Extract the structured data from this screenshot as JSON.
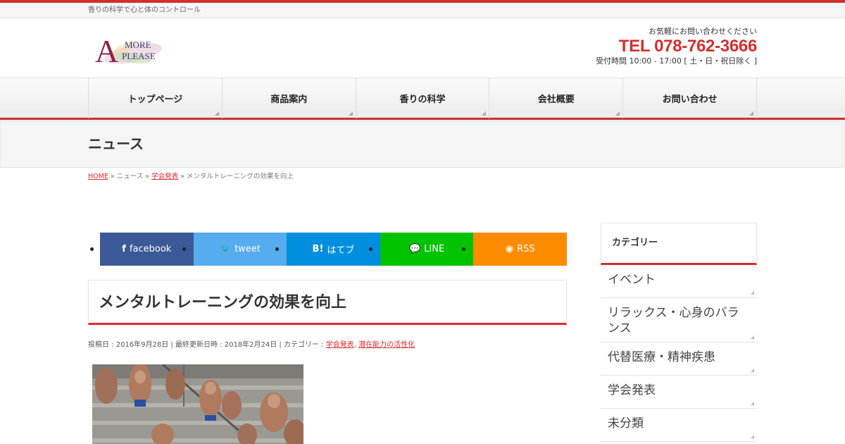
{
  "topbar": {
    "tagline": "香りの科学で心と体のコントロール"
  },
  "logo": {
    "letter": "A",
    "line1": "MORE",
    "line2": "PLEASE"
  },
  "contact": {
    "question": "お気軽にお問い合わせください",
    "tel": "TEL 078-762-3666",
    "hours": "受付時間 10:00 - 17:00 [ 土・日・祝日除く ]"
  },
  "nav": [
    "トップページ",
    "商品案内",
    "香りの科学",
    "会社概要",
    "お問い合わせ"
  ],
  "page_title": "ニュース",
  "breadcrumb": {
    "home": "HOME",
    "sep1": " » ニュース » ",
    "cat": "学会発表",
    "sep2": " » メンタルトレーニングの効果を向上"
  },
  "share": {
    "facebook": {
      "icon": "f",
      "label": "facebook"
    },
    "tweet": {
      "icon": "🐦",
      "label": "tweet"
    },
    "hatena": {
      "icon": "B!",
      "label": "はてブ"
    },
    "line": {
      "icon": "💬",
      "label": "LINE"
    },
    "rss": {
      "icon": "◉",
      "label": "RSS"
    }
  },
  "entry": {
    "title": "メンタルトレーニングの効果を向上",
    "meta_prefix": "投稿日 : 2016年9月28日 | 最終更新日時 : 2018年2月24日 | カテゴリー : ",
    "cat1": "学会発表",
    "comma": ", ",
    "cat2": "潜在能力の活性化"
  },
  "sidebar": {
    "heading": "カテゴリー",
    "items": [
      "イベント",
      "リラックス・心身のバランス",
      "代替医療・精神疾患",
      "学会発表",
      "未分類"
    ]
  },
  "colors": {
    "accent": "#d32f2f",
    "facebook": "#3b5998",
    "twitter": "#55acee",
    "hatena": "#008fde",
    "line": "#00c300",
    "rss": "#ff8c00"
  }
}
